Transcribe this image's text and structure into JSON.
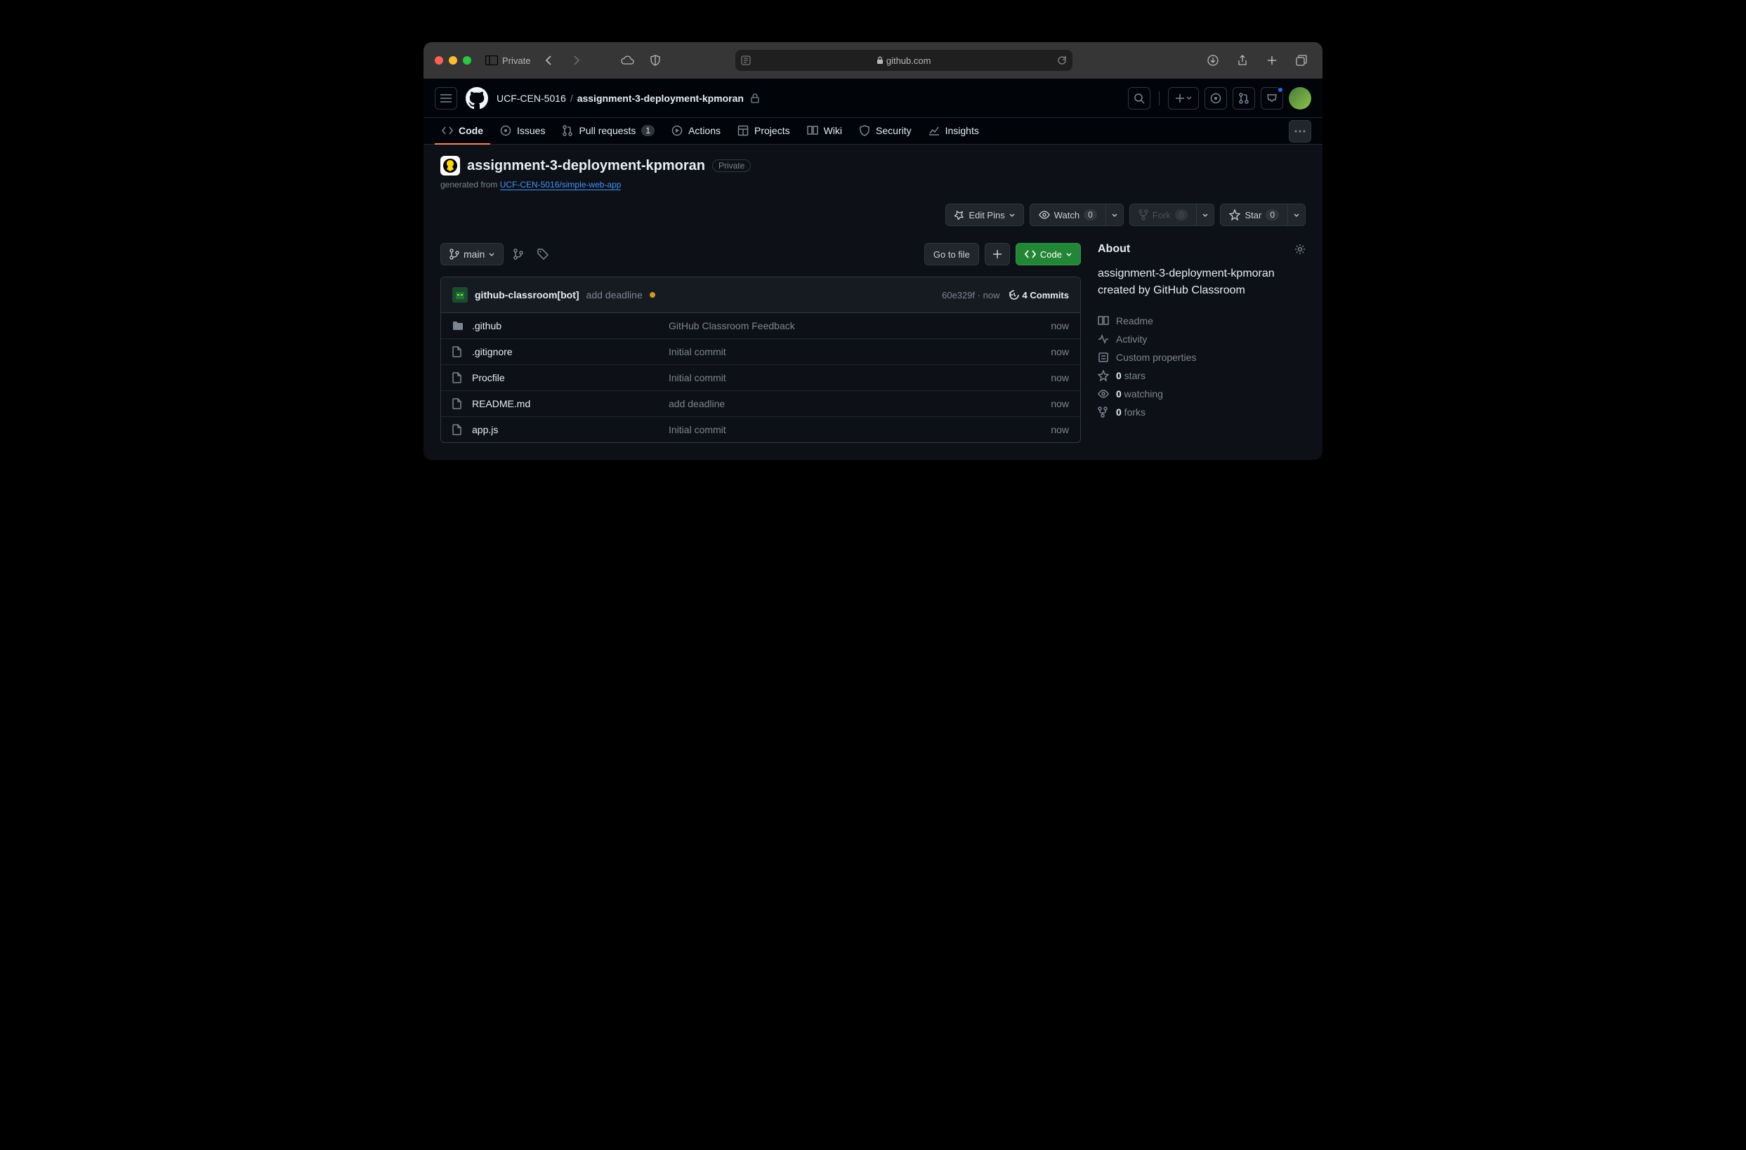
{
  "browser": {
    "sidebar_label": "Private",
    "url_host": "github.com"
  },
  "header": {
    "org": "UCF-CEN-5016",
    "repo": "assignment-3-deployment-kpmoran"
  },
  "tabs": {
    "code": "Code",
    "issues": "Issues",
    "pulls": "Pull requests",
    "pulls_count": "1",
    "actions": "Actions",
    "projects": "Projects",
    "wiki": "Wiki",
    "security": "Security",
    "insights": "Insights"
  },
  "repo": {
    "title": "assignment-3-deployment-kpmoran",
    "visibility": "Private",
    "generated_prefix": "generated from ",
    "generated_link": "UCF-CEN-5016/simple-web-app"
  },
  "actions": {
    "edit_pins": "Edit Pins",
    "watch": "Watch",
    "watch_count": "0",
    "fork": "Fork",
    "fork_count": "0",
    "star": "Star",
    "star_count": "0"
  },
  "toolbar": {
    "branch": "main",
    "go_to_file": "Go to file",
    "code": "Code"
  },
  "commit": {
    "author": "github-classroom[bot]",
    "message": "add deadline",
    "sha": "60e329f",
    "time": "now",
    "sep": " · ",
    "commits_count": "4 Commits"
  },
  "files": [
    {
      "name": ".github",
      "type": "dir",
      "msg": "GitHub Classroom Feedback",
      "time": "now"
    },
    {
      "name": ".gitignore",
      "type": "file",
      "msg": "Initial commit",
      "time": "now"
    },
    {
      "name": "Procfile",
      "type": "file",
      "msg": "Initial commit",
      "time": "now"
    },
    {
      "name": "README.md",
      "type": "file",
      "msg": "add deadline",
      "time": "now"
    },
    {
      "name": "app.js",
      "type": "file",
      "msg": "Initial commit",
      "time": "now"
    }
  ],
  "about": {
    "title": "About",
    "description": "assignment-3-deployment-kpmoran created by GitHub Classroom",
    "readme": "Readme",
    "activity": "Activity",
    "custom_props": "Custom properties",
    "stars_count": "0",
    "stars_label": " stars",
    "watching_count": "0",
    "watching_label": " watching",
    "forks_count": "0",
    "forks_label": " forks"
  }
}
